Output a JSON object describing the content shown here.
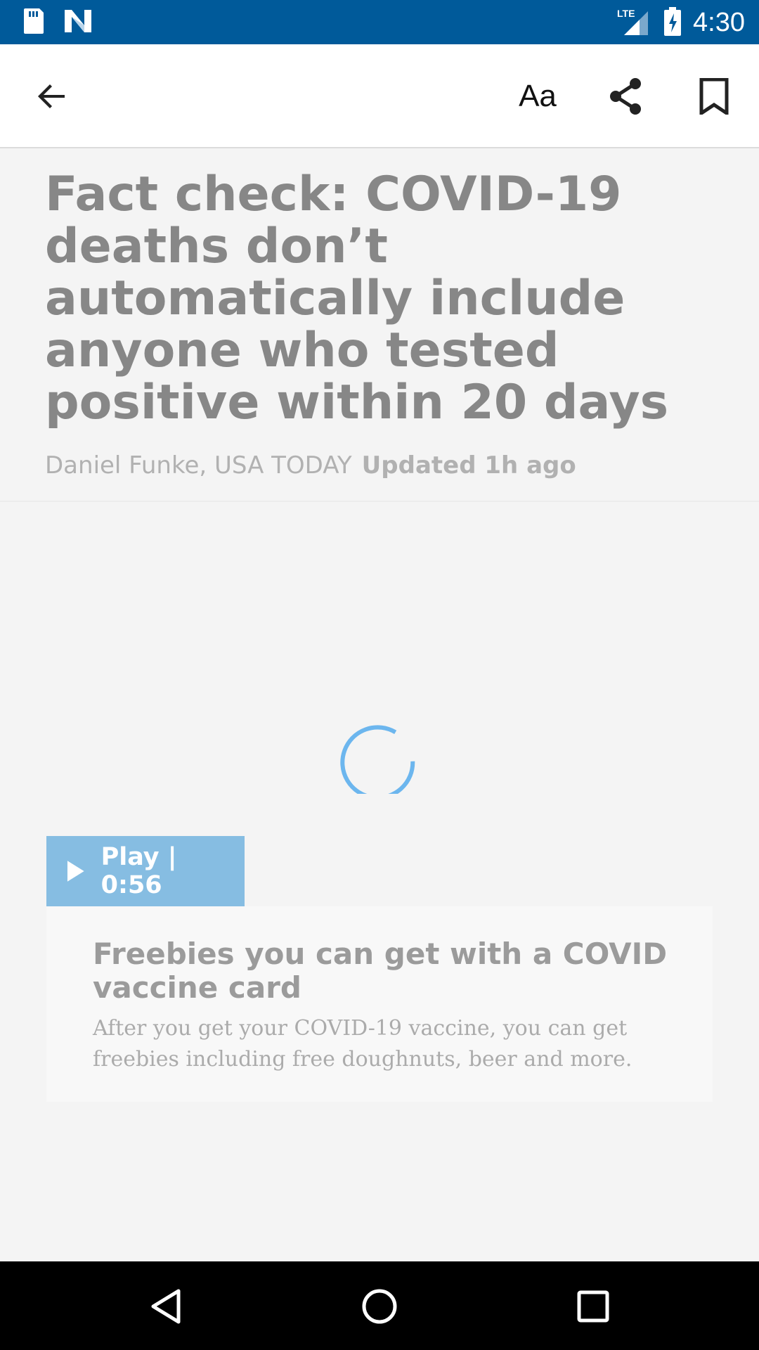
{
  "status_bar": {
    "time": "4:30",
    "icons": [
      "sd-card-icon",
      "n-notification-icon",
      "lte-signal-icon",
      "battery-charging-icon"
    ],
    "network_label": "LTE",
    "background": "#005a9a"
  },
  "toolbar": {
    "back_icon": "arrow-back-icon",
    "font_size_label": "Aa",
    "share_icon": "share-icon",
    "bookmark_icon": "bookmark-icon"
  },
  "article": {
    "title": "Fact check: COVID-19 deaths don’t automatically include anyone who tested positive within 20 days",
    "author": "Daniel Funke, USA TODAY",
    "updated": "Updated 1h ago"
  },
  "video": {
    "loading": true,
    "play_label": "Play | 0:56",
    "title": "Freebies you can get with a COVID vaccine card",
    "description": "After you get your COVID-19 vaccine, you can get freebies including free doughnuts, beer and more.",
    "accent_color": "#86bde2",
    "spinner_color": "#6cb6ee"
  },
  "nav_bar": {
    "buttons": [
      "nav-back-icon",
      "nav-home-icon",
      "nav-recents-icon"
    ]
  }
}
